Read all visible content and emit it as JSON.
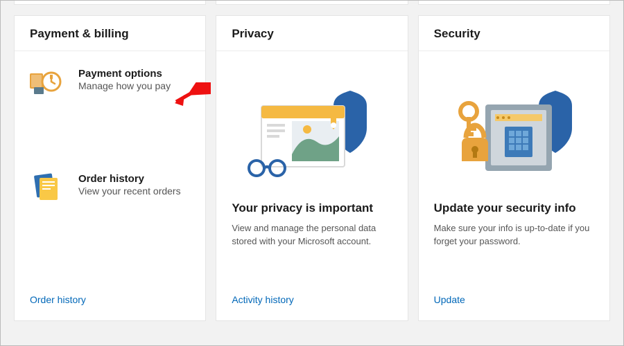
{
  "cards": {
    "billing": {
      "title": "Payment & billing",
      "items": [
        {
          "title": "Payment options",
          "sub": "Manage how you pay"
        },
        {
          "title": "Order history",
          "sub": "View your recent orders"
        }
      ],
      "footer_link": "Order history"
    },
    "privacy": {
      "title": "Privacy",
      "heading": "Your privacy is important",
      "desc": "View and manage the personal data stored with your Microsoft account.",
      "footer_link": "Activity history"
    },
    "security": {
      "title": "Security",
      "heading": "Update your security info",
      "desc": "Make sure your info is up-to-date if you forget your password.",
      "footer_link": "Update"
    }
  }
}
